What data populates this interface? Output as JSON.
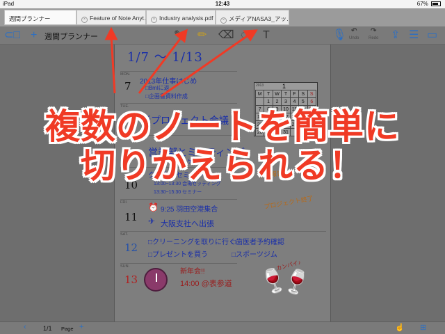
{
  "status": {
    "device": "iPad",
    "time": "12:43",
    "battery": "67%"
  },
  "tabs": [
    {
      "label": "週間プランナー",
      "active": true
    },
    {
      "label": "Feature of Note Anyt…",
      "active": false
    },
    {
      "label": "Industry analysis.pdf",
      "active": false
    },
    {
      "label": "メディアNASA3_アッ…",
      "active": false
    }
  ],
  "toolbar": {
    "title": "週間プランナー",
    "undo_label": "Undo",
    "redo_label": "Redo",
    "icons": [
      "folder-icon",
      "plus-icon",
      "pen-icon",
      "highlighter-icon",
      "eraser-icon",
      "lasso-icon",
      "text-icon",
      "mic-icon",
      "undo-icon",
      "redo-icon",
      "share-icon",
      "list-icon",
      "comment-icon"
    ]
  },
  "planner": {
    "week_title": "1/7 ～ 1/13",
    "days": [
      {
        "name": "MON.",
        "num": "7",
        "color": "normal",
        "lines": [
          "2013年仕事はじめ",
          "□Bmlに返",
          "□企画書資料作成"
        ]
      },
      {
        "name": "TUE.",
        "num": "",
        "color": "normal",
        "lines": [
          "新プロジェクト会議"
        ]
      },
      {
        "name": "WED.",
        "num": "",
        "color": "normal",
        "lines": [
          "営業部とミーティング",
          "マーケ調査"
        ]
      },
      {
        "name": "THU.",
        "num": "10",
        "color": "normal",
        "lines": [
          "クラウドセミナー",
          "13:00~13:30 会場セッティング",
          "13:30~15:30 セミナー"
        ]
      },
      {
        "name": "FRI.",
        "num": "11",
        "color": "normal",
        "lines": [
          "9:25 羽田空港集合",
          "大阪支社へ出張"
        ]
      },
      {
        "name": "SAT.",
        "num": "12",
        "color": "blue",
        "lines": [
          "□クリーニングを取りに行く",
          "□プレゼントを買う",
          "□歯医者予約確認",
          "□スポーツジム"
        ]
      },
      {
        "name": "SUN.",
        "num": "13",
        "color": "red",
        "lines": [
          "新年会!!",
          "14:00 @表参道"
        ]
      }
    ],
    "side_notes": [
      "中間報告",
      "プロジェクト終了",
      "カンパイ♪"
    ]
  },
  "calendar": {
    "year": "2013",
    "month": "1",
    "headers": [
      "M",
      "T",
      "W",
      "T",
      "F",
      "S",
      "S"
    ],
    "rows": [
      [
        "",
        "1",
        "2",
        "3",
        "4",
        "5",
        "6"
      ],
      [
        "7",
        "8",
        "9",
        "10",
        "11",
        "12",
        "13"
      ],
      [
        "14",
        "15",
        "16",
        "17",
        "18",
        "19",
        "20"
      ],
      [
        "21",
        "22",
        "23",
        "24",
        "25",
        "26",
        "27"
      ],
      [
        "28",
        "29",
        "30",
        "31",
        "",
        "",
        ""
      ]
    ]
  },
  "caption": {
    "line1": "複数のノートを簡単に",
    "line2": "切りかえられる！"
  },
  "bottom": {
    "page_count": "1/1",
    "page_label": "Page"
  },
  "colors": {
    "accent": "#2d6fc2",
    "caption": "#f03a25",
    "arrow": "#f03a25"
  }
}
